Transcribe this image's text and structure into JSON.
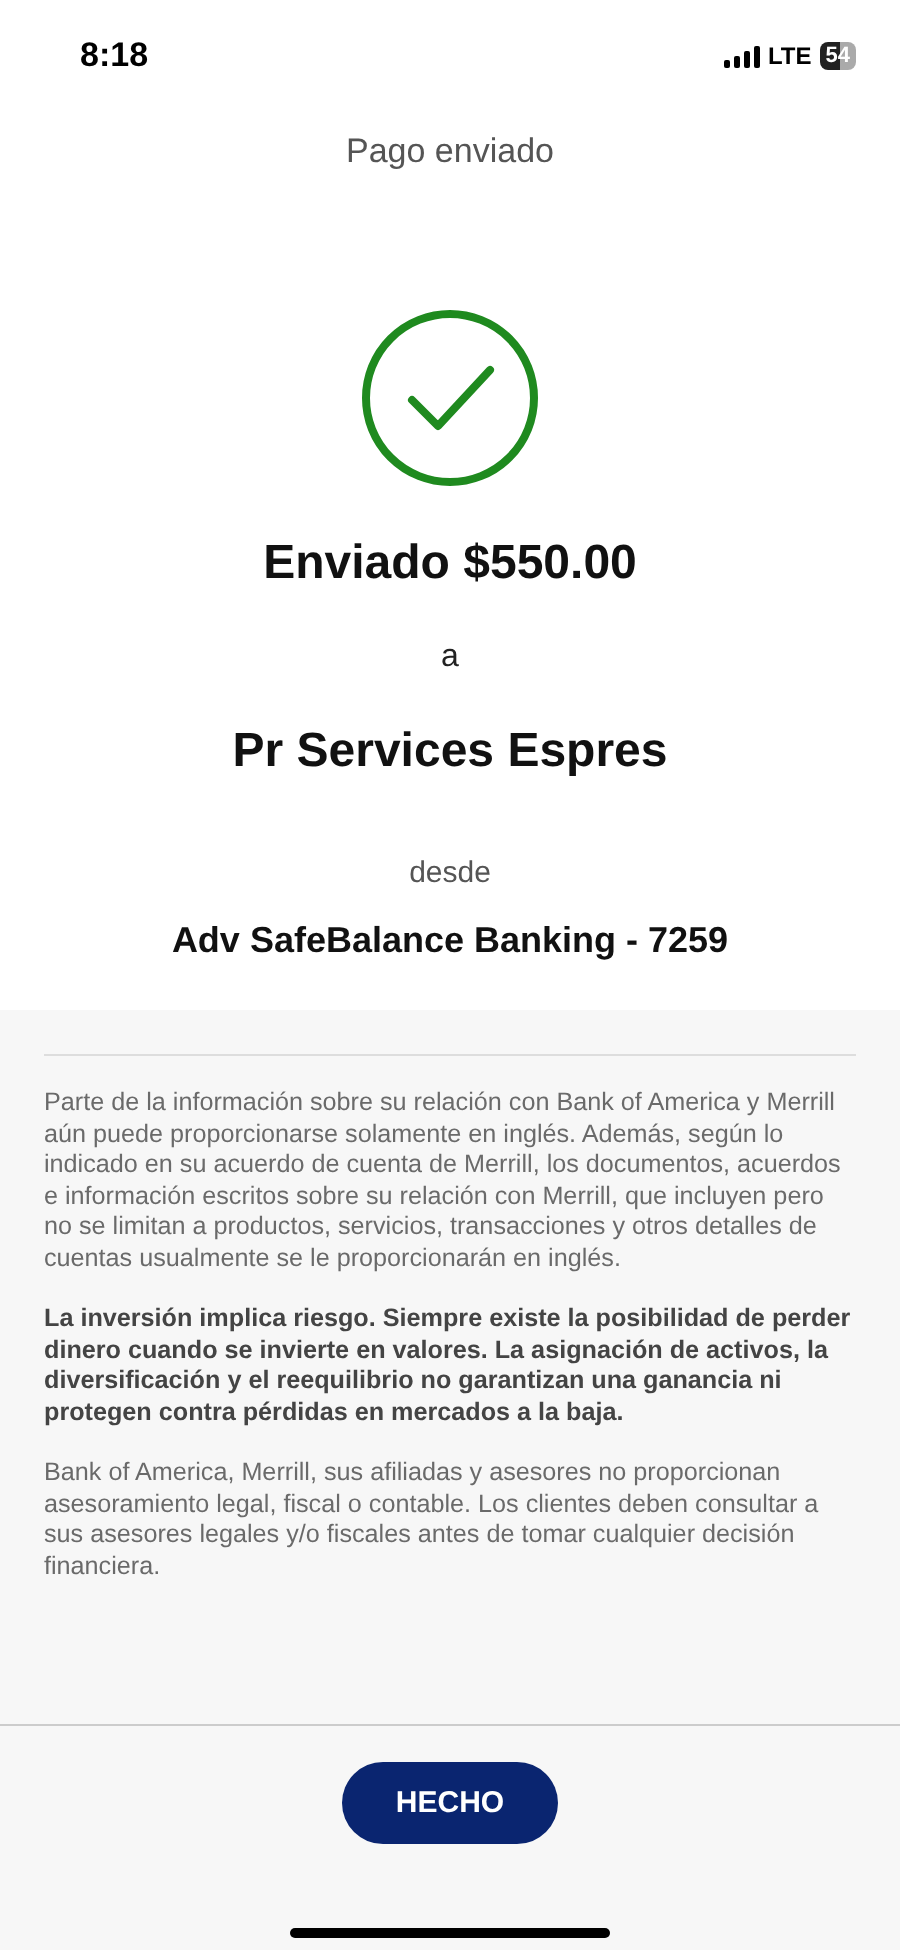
{
  "status_bar": {
    "time": "8:18",
    "network": "LTE",
    "battery": "54"
  },
  "header": {
    "title": "Pago enviado"
  },
  "confirmation": {
    "amount_line": "Enviado $550.00",
    "connector": "a",
    "recipient": "Pr Services Espres",
    "from_label": "desde",
    "account": "Adv SafeBalance Banking - 7259"
  },
  "disclaimers": [
    {
      "text": "Parte de la información sobre su relación con Bank of America y Merrill aún puede proporcionarse solamente en inglés. Además, según lo indicado en su acuerdo de cuenta de Merrill, los documentos, acuerdos e información escritos sobre su relación con Merrill, que incluyen pero no se limitan a productos, servicios, transacciones y otros detalles de cuentas usualmente se le proporcionarán en inglés.",
      "bold": false
    },
    {
      "text": "La inversión implica riesgo. Siempre existe la posibilidad de perder dinero cuando se invierte en valores. La asignación de activos, la diversificación y el reequilibrio no garantizan una ganancia ni protegen contra pérdidas en mercados a la baja.",
      "bold": true
    },
    {
      "text": "Bank of America, Merrill, sus afiliadas y asesores no proporcionan asesoramiento legal, fiscal o contable. Los clientes deben consultar a sus asesores legales y/o fiscales antes de tomar cualquier decisión financiera.",
      "bold": false
    }
  ],
  "done_button": {
    "label": "HECHO"
  }
}
